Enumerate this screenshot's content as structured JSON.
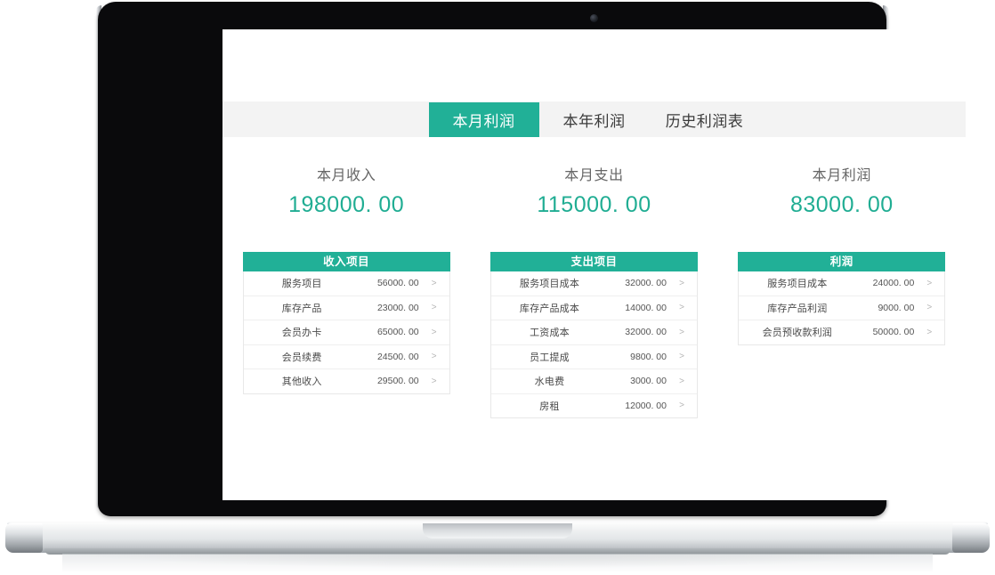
{
  "device": {
    "type": "laptop",
    "webcam": "webcam-dot"
  },
  "tabs": [
    {
      "label": "本月利润",
      "active": true
    },
    {
      "label": "本年利润",
      "active": false
    },
    {
      "label": "历史利润表",
      "active": false
    }
  ],
  "summary": [
    {
      "label": "本月收入",
      "value": "198000. 00"
    },
    {
      "label": "本月支出",
      "value": "115000. 00"
    },
    {
      "label": "本月利润",
      "value": "83000. 00"
    }
  ],
  "tables": [
    {
      "header": "收入项目",
      "rows": [
        {
          "name": "服务项目",
          "value": "56000. 00",
          "arrow": ">"
        },
        {
          "name": "库存产品",
          "value": "23000. 00",
          "arrow": ">"
        },
        {
          "name": "会员办卡",
          "value": "65000. 00",
          "arrow": ">"
        },
        {
          "name": "会员续费",
          "value": "24500. 00",
          "arrow": ">"
        },
        {
          "name": "其他收入",
          "value": "29500. 00",
          "arrow": ">"
        }
      ]
    },
    {
      "header": "支出项目",
      "rows": [
        {
          "name": "服务项目成本",
          "value": "32000. 00",
          "arrow": ">"
        },
        {
          "name": "库存产品成本",
          "value": "14000. 00",
          "arrow": ">"
        },
        {
          "name": "工资成本",
          "value": "32000. 00",
          "arrow": ">"
        },
        {
          "name": "员工提成",
          "value": "9800. 00",
          "arrow": ">"
        },
        {
          "name": "水电费",
          "value": "3000. 00",
          "arrow": ">"
        },
        {
          "name": "房租",
          "value": "12000. 00",
          "arrow": ">"
        }
      ]
    },
    {
      "header": "利润",
      "rows": [
        {
          "name": "服务项目成本",
          "value": "24000. 00",
          "arrow": ">"
        },
        {
          "name": "库存产品利润",
          "value": "9000. 00",
          "arrow": ">"
        },
        {
          "name": "会员预收款利润",
          "value": "50000. 00",
          "arrow": ">"
        }
      ]
    }
  ],
  "colors": {
    "accent": "#21b097",
    "value_text": "#20ad93",
    "tabbar_bg": "#f3f3f3",
    "label_text": "#666666",
    "row_text": "#4a4a4a",
    "border": "#e8e8e8"
  }
}
